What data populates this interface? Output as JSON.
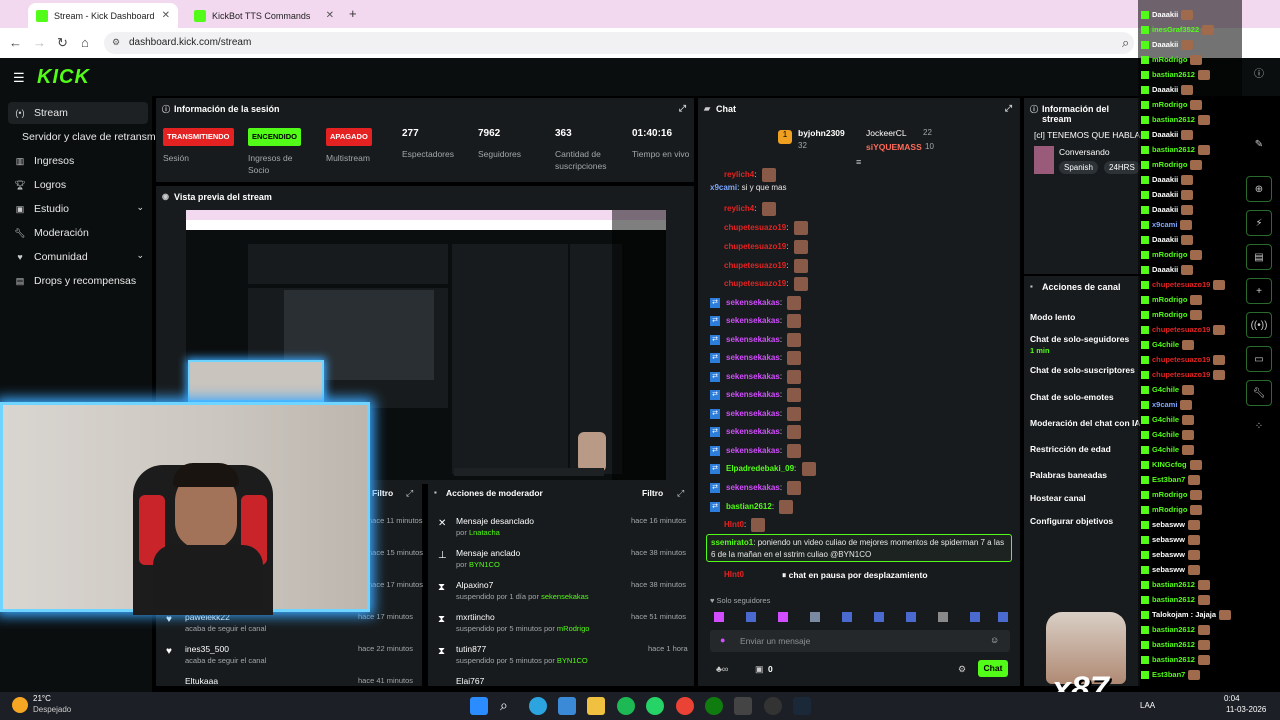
{
  "browser": {
    "tabs": [
      {
        "label": "Stream - Kick Dashboard"
      },
      {
        "label": "KickBot TTS Commands"
      }
    ],
    "url": "dashboard.kick.com/stream"
  },
  "kick": {
    "logo": "KICK"
  },
  "sidebar": {
    "items": [
      {
        "label": "Stream"
      },
      {
        "label": "Servidor y clave de retransm"
      },
      {
        "label": "Ingresos"
      },
      {
        "label": "Logros"
      },
      {
        "label": "Estudio"
      },
      {
        "label": "Moderación"
      },
      {
        "label": "Comunidad"
      },
      {
        "label": "Drops y recompensas"
      }
    ]
  },
  "session": {
    "title": "Información de la sesión",
    "stats": [
      {
        "badge": "TRANSMITIENDO",
        "label": "Sesión",
        "color": "#e52222"
      },
      {
        "badge": "ENCENDIDO",
        "label": "Ingresos de Socio",
        "color": "#53fc18"
      },
      {
        "badge": "APAGADO",
        "label": "Multistream",
        "color": "#e52222"
      },
      {
        "value": "277",
        "label": "Espectadores"
      },
      {
        "value": "7962",
        "label": "Seguidores"
      },
      {
        "value": "363",
        "label": "Cantidad de suscripciones"
      },
      {
        "value": "01:40:16",
        "label": "Tiempo en vivo"
      }
    ]
  },
  "preview": {
    "title": "Vista previa del stream"
  },
  "activity": {
    "filter": "Filtro",
    "rows": [
      {
        "time": "hace 11 minutos"
      },
      {
        "time": "hace 15 minutos"
      },
      {
        "time": "hace 17 minutos"
      },
      {
        "name": "paweiekk22",
        "sub": "acaba de seguir el canal",
        "time": "hace 17 minutos"
      },
      {
        "name": "ines35_500",
        "sub": "acaba de seguir el canal",
        "time": "hace 22 minutos"
      },
      {
        "name": "Eltukaaa",
        "time": "hace 41 minutos"
      }
    ]
  },
  "modactions": {
    "title": "Acciones de moderador",
    "filter": "Filtro",
    "rows": [
      {
        "name": "Mensaje desanclado",
        "by": "por ",
        "actor": "Lnatacha",
        "time": "hace 16 minutos"
      },
      {
        "name": "Mensaje anclado",
        "by": "por ",
        "actor": "BYN1CO",
        "time": "hace 38 minutos"
      },
      {
        "name": "Alpaxino7",
        "by": "suspendido por 1 día por ",
        "actor": "sekensekakas",
        "time": "hace 38 minutos"
      },
      {
        "name": "mxrtiincho",
        "by": "suspendido por 5 minutos por ",
        "actor": "mRodrigo",
        "time": "hace 51 minutos"
      },
      {
        "name": "tutin877",
        "by": "suspendido por 5 minutos por ",
        "actor": "BYN1CO",
        "time": "hace 1 hora"
      },
      {
        "name": "Elai767",
        "by": "",
        "actor": "",
        "time": ""
      }
    ]
  },
  "chat": {
    "title": "Chat",
    "top": [
      {
        "name": "byjohn2309",
        "count": "32"
      },
      {
        "name": "JockeerCL",
        "count": "22"
      },
      {
        "name": "siYQUEMASS",
        "count": "10"
      }
    ],
    "messages": [
      {
        "user": "reylich4",
        "text": "",
        "color": "#e52222"
      },
      {
        "user": "x9cami",
        "text": "si y que mas",
        "color": "#7ea7ff"
      },
      {
        "user": "reylich4",
        "text": "",
        "color": "#e52222"
      },
      {
        "user": "chupetesuazo19",
        "text": "",
        "color": "#e52222"
      },
      {
        "user": "chupetesuazo19",
        "text": "",
        "color": "#e52222"
      },
      {
        "user": "chupetesuazo19",
        "text": "",
        "color": "#e52222"
      },
      {
        "user": "chupetesuazo19",
        "text": "",
        "color": "#e52222"
      },
      {
        "user": "sekensekakas",
        "text": "",
        "color": "#d24dff"
      },
      {
        "user": "sekensekakas",
        "text": "",
        "color": "#d24dff"
      },
      {
        "user": "sekensekakas",
        "text": "",
        "color": "#d24dff"
      },
      {
        "user": "sekensekakas",
        "text": "",
        "color": "#d24dff"
      },
      {
        "user": "sekensekakas",
        "text": "",
        "color": "#d24dff"
      },
      {
        "user": "sekensekakas",
        "text": "",
        "color": "#d24dff"
      },
      {
        "user": "sekensekakas",
        "text": "",
        "color": "#d24dff"
      },
      {
        "user": "sekensekakas",
        "text": "",
        "color": "#d24dff"
      },
      {
        "user": "sekensekakas",
        "text": "",
        "color": "#d24dff"
      },
      {
        "user": "Elpadredebaki_09",
        "text": "",
        "color": "#53fc18"
      },
      {
        "user": "sekensekakas",
        "text": "",
        "color": "#d24dff"
      },
      {
        "user": "bastian2612",
        "text": "",
        "color": "#53fc18"
      },
      {
        "user": "Hlnt0",
        "text": "",
        "color": "#e52222"
      }
    ],
    "highlight": {
      "user": "ssemirato1",
      "text": "poniendo un video culiao de mejores momentos de spiderman 7 a las 6 de la mañan en el sstrim culiao @BYN1CO"
    },
    "paused_user": "Hlnt0",
    "paused": "chat en pausa por desplazamiento",
    "followers_only": "Solo seguidores",
    "input_placeholder": "Enviar un mensaje",
    "points": "0",
    "send": "Chat"
  },
  "channel_info": {
    "title": "Información del stream",
    "stream_title": "[cl] TENEMOS QUE HABLAR",
    "category": "Conversando",
    "tags": [
      "Spanish",
      "24HRS"
    ]
  },
  "channel_actions": {
    "title": "Acciones de canal",
    "items": [
      {
        "label": "Modo lento",
        "sub": ""
      },
      {
        "label": "Chat de solo-seguidores",
        "sub": "1 min"
      },
      {
        "label": "Chat de solo-suscriptores",
        "sub": ""
      },
      {
        "label": "Chat de solo-emotes",
        "sub": ""
      },
      {
        "label": "Moderación del chat con IA",
        "sub": ""
      },
      {
        "label": "Restricción de edad",
        "sub": ""
      },
      {
        "label": "Palabras baneadas",
        "sub": ""
      },
      {
        "label": "Hostear canal",
        "sub": ""
      },
      {
        "label": "Configurar objetivos",
        "sub": ""
      }
    ]
  },
  "overlay_chat": [
    {
      "user": "Daaakii",
      "color": "#ffffff"
    },
    {
      "user": "inesGraf3522",
      "color": "#53fc18"
    },
    {
      "user": "Daaakii",
      "color": "#ffffff"
    },
    {
      "user": "mRodrigo",
      "color": "#53fc18"
    },
    {
      "user": "bastian2612",
      "color": "#53fc18"
    },
    {
      "user": "Daaakii",
      "color": "#ffffff"
    },
    {
      "user": "mRodrigo",
      "color": "#53fc18"
    },
    {
      "user": "bastian2612",
      "color": "#53fc18"
    },
    {
      "user": "Daaakii",
      "color": "#ffffff"
    },
    {
      "user": "bastian2612",
      "color": "#53fc18"
    },
    {
      "user": "mRodrigo",
      "color": "#53fc18"
    },
    {
      "user": "Daaakii",
      "color": "#ffffff"
    },
    {
      "user": "Daaakii",
      "color": "#ffffff"
    },
    {
      "user": "Daaakii",
      "color": "#ffffff"
    },
    {
      "user": "x9cami",
      "color": "#7ea7ff"
    },
    {
      "user": "Daaakii",
      "color": "#ffffff"
    },
    {
      "user": "mRodrigo",
      "color": "#53fc18"
    },
    {
      "user": "Daaakii",
      "color": "#ffffff"
    },
    {
      "user": "chupetesuazo19",
      "color": "#e52222"
    },
    {
      "user": "mRodrigo",
      "color": "#53fc18"
    },
    {
      "user": "mRodrigo",
      "color": "#53fc18"
    },
    {
      "user": "chupetesuazo19",
      "color": "#e52222"
    },
    {
      "user": "G4chile",
      "color": "#53fc18"
    },
    {
      "user": "chupetesuazo19",
      "color": "#e52222"
    },
    {
      "user": "chupetesuazo19",
      "color": "#e52222"
    },
    {
      "user": "G4chile",
      "color": "#53fc18"
    },
    {
      "user": "x9cami",
      "color": "#7ea7ff"
    },
    {
      "user": "G4chile",
      "color": "#53fc18"
    },
    {
      "user": "G4chile",
      "color": "#53fc18"
    },
    {
      "user": "G4chile",
      "color": "#53fc18"
    },
    {
      "user": "KINGcfog",
      "color": "#53fc18"
    },
    {
      "user": "Est3ban7",
      "color": "#53fc18"
    },
    {
      "user": "mRodrigo",
      "color": "#53fc18"
    },
    {
      "user": "mRodrigo",
      "color": "#53fc18"
    },
    {
      "user": "sebasww",
      "color": "#ffffff"
    },
    {
      "user": "sebasww",
      "color": "#ffffff"
    },
    {
      "user": "sebasww",
      "color": "#ffffff"
    },
    {
      "user": "sebasww",
      "color": "#ffffff"
    },
    {
      "user": "bastian2612",
      "color": "#53fc18"
    },
    {
      "user": "bastian2612",
      "color": "#53fc18"
    },
    {
      "user": "Talokojam : Jajaja",
      "color": "#ffffff"
    },
    {
      "user": "bastian2612",
      "color": "#53fc18"
    },
    {
      "user": "bastian2612",
      "color": "#53fc18"
    },
    {
      "user": "bastian2612",
      "color": "#53fc18"
    },
    {
      "user": "Est3ban7",
      "color": "#53fc18"
    }
  ],
  "overlay_logo": "x87",
  "taskbar": {
    "temp": "21°C",
    "weather": "Despejado",
    "lang": "LAA",
    "time": "0:04",
    "date": "11-03-2026"
  }
}
